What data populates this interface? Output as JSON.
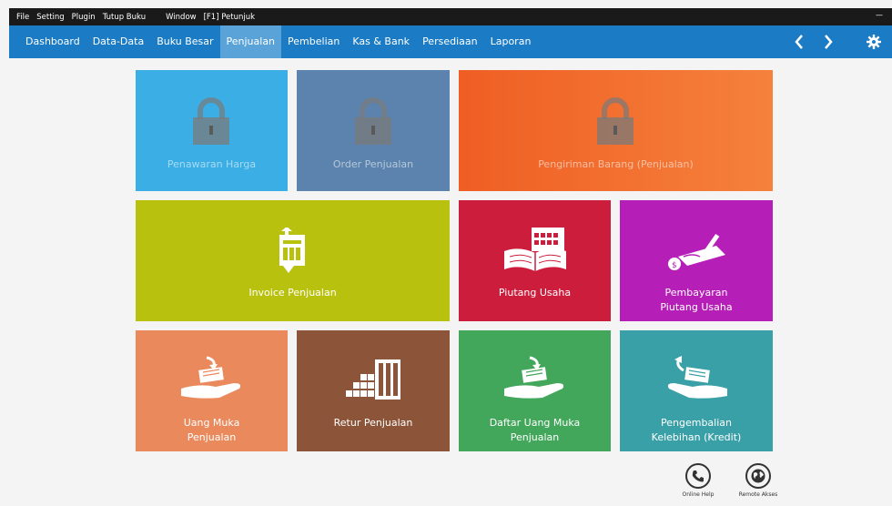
{
  "menubar": {
    "items": [
      "File",
      "Setting",
      "Plugin",
      "Tutup Buku",
      "Window",
      "[F1] Petunjuk"
    ],
    "minimize": "—"
  },
  "nav": {
    "items": [
      "Dashboard",
      "Data-Data",
      "Buku Besar",
      "Penjualan",
      "Pembelian",
      "Kas & Bank",
      "Persediaan",
      "Laporan"
    ],
    "active": "Penjualan"
  },
  "tiles": {
    "penawaran": {
      "label": "Penawaran Harga",
      "color": "#3aaee5",
      "locked": true
    },
    "order": {
      "label": "Order Penjualan",
      "color": "#5b83ad",
      "locked": true
    },
    "pengiriman": {
      "label": "Pengiriman Barang (Penjualan)",
      "color": "#f26a2a",
      "locked": true
    },
    "invoice": {
      "label": "Invoice Penjualan",
      "color": "#b9c10f"
    },
    "piutang": {
      "label": "Piutang Usaha",
      "color": "#cd1d3d"
    },
    "pembayaran": {
      "label1": "Pembayaran",
      "label2": "Piutang Usaha",
      "color": "#b51fb8"
    },
    "uangmuka": {
      "label1": "Uang Muka",
      "label2": "Penjualan",
      "color": "#ea8a5c"
    },
    "retur": {
      "label": "Retur Penjualan",
      "color": "#8c5438"
    },
    "daftar": {
      "label1": "Daftar Uang Muka",
      "label2": "Penjualan",
      "color": "#42a65b"
    },
    "pengembalian": {
      "label1": "Pengembalian",
      "label2": "Kelebihan (Kredit)",
      "color": "#3aa0a8"
    }
  },
  "footer": {
    "online_help": "Online Help",
    "remote_akses": "Remote Akses"
  }
}
